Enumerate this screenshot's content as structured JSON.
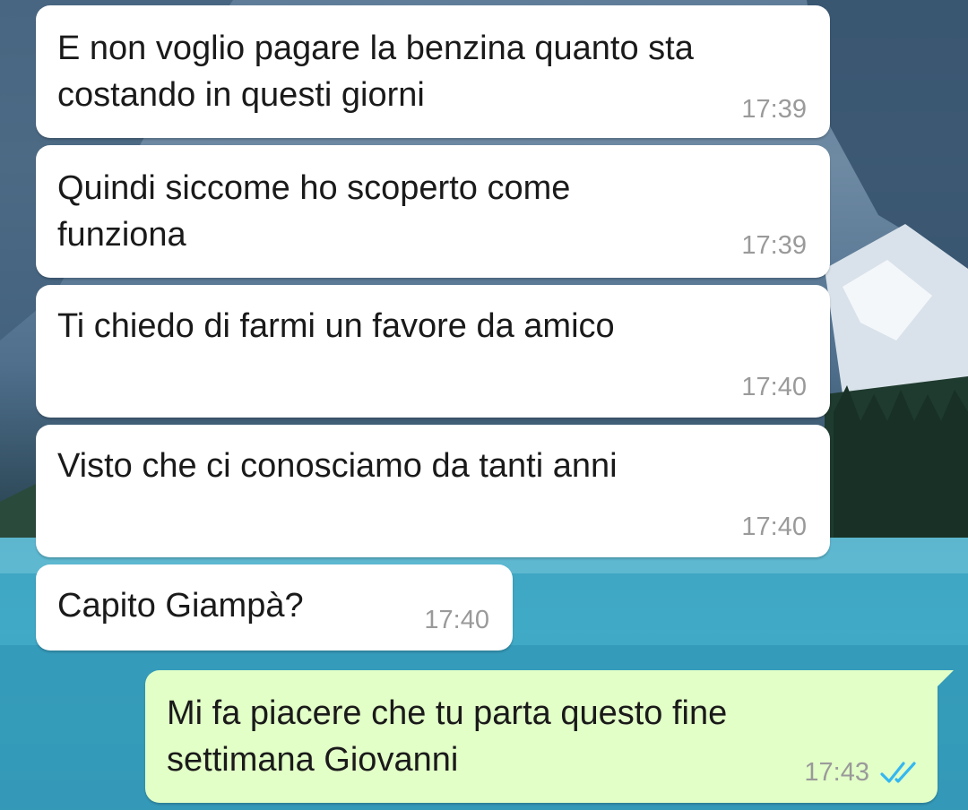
{
  "conversation": {
    "messages": [
      {
        "direction": "incoming",
        "text": "E non voglio pagare la benzina quanto sta\ncostando in questi giorni",
        "time": "17:39"
      },
      {
        "direction": "incoming",
        "text": "Quindi siccome ho scoperto come\nfunziona",
        "time": "17:39"
      },
      {
        "direction": "incoming",
        "text": "Ti chiedo di farmi un favore da amico",
        "time": "17:40"
      },
      {
        "direction": "incoming",
        "text": "Visto che ci conosciamo da tanti anni",
        "time": "17:40"
      },
      {
        "direction": "incoming",
        "text": "Capito Giampà?",
        "time": "17:40"
      },
      {
        "direction": "outgoing",
        "text": "Mi fa piacere che tu parta questo fine\nsettimana Giovanni",
        "time": "17:43",
        "status_icon": "double-check-read-icon"
      }
    ]
  },
  "colors": {
    "incoming_bubble": "#ffffff",
    "outgoing_bubble": "#e2ffc7",
    "time_text": "#9a9a9a",
    "read_ticks": "#34b7f1"
  }
}
